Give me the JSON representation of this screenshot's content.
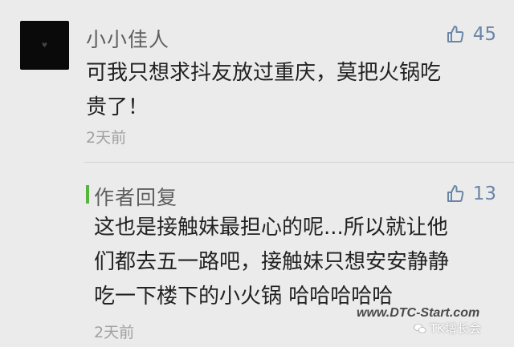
{
  "comment": {
    "avatar_icon": "heart-icon",
    "username": "小小佳人",
    "likes": "45",
    "content_lines": [
      "可我只想求抖友放过重庆，莫把火锅吃",
      "贵了！"
    ],
    "time": "2天前"
  },
  "reply": {
    "label": "作者回复",
    "likes": "13",
    "content_lines": [
      "这也是接触妹最担心的呢...所以就让他",
      "们都去五一路吧，接触妹只想安安静静",
      "吃一下楼下的小火锅 哈哈哈哈哈"
    ],
    "time": "2天前"
  },
  "watermark": {
    "url": "www.DTC-Start.com",
    "brand": "TK增长会"
  },
  "colors": {
    "background": "#ebebeb",
    "like": "#6a86a6",
    "reply_bar": "#57b53f"
  }
}
